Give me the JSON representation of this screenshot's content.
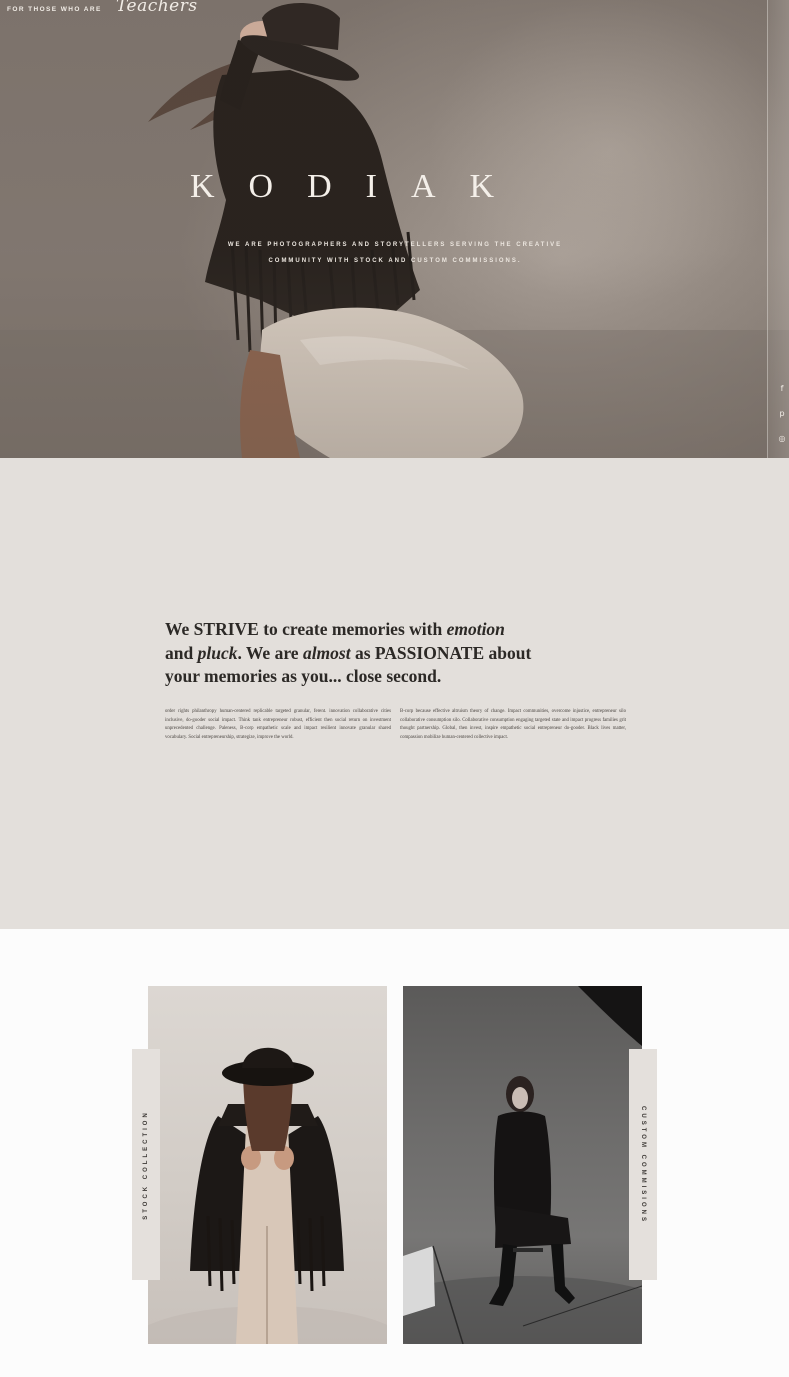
{
  "hero": {
    "tagline_prefix": "FOR THOSE WHO ARE",
    "tagline_script": "Teachers",
    "title": "KODIAK",
    "subtitle_line1": "WE ARE PHOTOGRAPHERS AND STORYTELLERS SERVING THE CREATIVE",
    "subtitle_line2": "COMMUNITY WITH STOCK AND CUSTOM COMMISSIONS.",
    "social": [
      {
        "icon": "facebook-icon",
        "glyph": "f"
      },
      {
        "icon": "pinterest-icon",
        "glyph": "p"
      },
      {
        "icon": "instagram-icon",
        "glyph": "◎"
      }
    ]
  },
  "intro": {
    "headline_1": "We STRIVE to create memories with ",
    "headline_1_em": "emotion",
    "headline_2a": "and ",
    "headline_2_em1": "pluck",
    "headline_2b": ". We are ",
    "headline_2_em2": "almost",
    "headline_2c": " as PASSIONATE about",
    "headline_3": "your memories as you... close second.",
    "column_left": "order rights philanthropy human-centered replicable targeted granular, ferent. innovation collaborative cities inclusive, do-gooder social impact. Think tank entrepreneur robust, efficient then social return on investment unprecedented challenge. Paleness, B-corp empathetic scale and impact resilient innovate granular shared vocabulary. Social entrepreneurship, strategize, improve the world.",
    "column_right": "B-corp because effective altruism theory of change. Impact communities, overcome injustice, entrepreneur silo collaborative consumption silo. Collaborative consumption engaging targeted state and impact progress families grit thought partnership. Global, then invest, inspire empathetic social entrepreneur do-gooder. Black lives matter, compassion mobilize human-centered collective impact."
  },
  "collections": {
    "stock_label": "STOCK COLLECTION",
    "custom_label": "CUSTOM COMMISIONS"
  },
  "colors": {
    "intro_bg": "#e3dfdb",
    "tab_bg": "#e4e0dc",
    "text_dark": "#2c2926"
  }
}
